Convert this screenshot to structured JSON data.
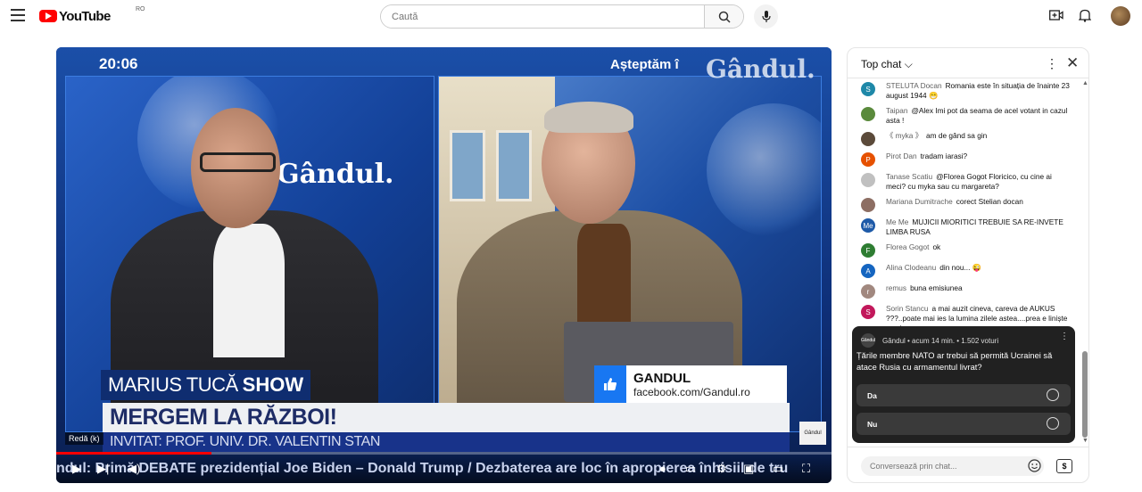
{
  "header": {
    "logo_text": "YouTube",
    "region": "RO",
    "search_placeholder": "Caută",
    "icons": [
      "menu-icon",
      "search-icon",
      "mic-icon",
      "create-icon",
      "bell-icon"
    ]
  },
  "player": {
    "time_overlay": "20:06",
    "upcoming": "Așteptăm î",
    "brand": "Gândul.",
    "inset_brand": "Gândul.",
    "show_name": "MARIUS TUCĂ",
    "show_suffix": "SHOW",
    "headline": "MERGEM LA RĂZBOI!",
    "guest": "INVITAT: PROF. UNIV. DR. VALENTIN STAN",
    "fb_title": "GANDUL",
    "fb_url": "facebook.com/Gandul.ro",
    "small_logo": "Gândul",
    "tooltip": "Redă (k)",
    "ticker": "ndul: Primă DEBATE prezidențial Joe Biden – Donald Trump / Dezbaterea are loc în apropierea înhisiil de tru",
    "progress_fraction": 0.2,
    "colors": {
      "progress": "#ff0000",
      "headline": "#1e2c66"
    }
  },
  "chat": {
    "title": "Top chat",
    "messages": [
      {
        "initial": "S",
        "color": "#1e88a8",
        "author": "STELUTA Docan",
        "text": "Romania este în situația de înainte 23 august 1944 😁"
      },
      {
        "initial": "",
        "color": "#5a8a3c",
        "author": "Taipan",
        "text": "@Alex Imi pot da seama de acel votant in cazul asta !"
      },
      {
        "initial": "",
        "color": "#5b4a3a",
        "author": "《 myka 》",
        "text": "am de gând sa gin"
      },
      {
        "initial": "P",
        "color": "#e65100",
        "author": "Pirot Dan",
        "text": "tradam iarasi?"
      },
      {
        "initial": "",
        "color": "#c0c0c0",
        "author": "Tanase Scatiu",
        "text": "@Florea Gogot Floricico, cu cine ai meci? cu myka sau cu margareta?"
      },
      {
        "initial": "",
        "color": "#8d6e63",
        "author": "Mariana Dumitrache",
        "text": "corect Stelian docan"
      },
      {
        "initial": "Me",
        "color": "#1e5aa8",
        "author": "Me Me",
        "text": "MUJICII MIORITICI TREBUIE SA RE-INVETE LIMBA RUSA"
      },
      {
        "initial": "F",
        "color": "#2e7d32",
        "author": "Florea Gogot",
        "text": "ok"
      },
      {
        "initial": "A",
        "color": "#1565c0",
        "author": "Alina Clodeanu",
        "text": "din nou... 😜"
      },
      {
        "initial": "r",
        "color": "#a1887f",
        "author": "remus",
        "text": "buna emisiunea"
      },
      {
        "initial": "S",
        "color": "#c2185b",
        "author": "Sorin Stancu",
        "text": "a mai auzit cineva, careva de AUKUS ???..poate mai ies la lumina zilele astea....prea e liniște cu ei..."
      }
    ],
    "poll": {
      "logo": "Gândul",
      "meta": "Gândul • acum 14 min. • 1.502 voturi",
      "question": "Țările membre NATO ar trebui să permită Ucrainei să atace Rusia cu armamentul livrat?",
      "options": [
        "Da",
        "Nu"
      ]
    },
    "input_placeholder": "Conversează prin chat...",
    "super_label": "$"
  }
}
